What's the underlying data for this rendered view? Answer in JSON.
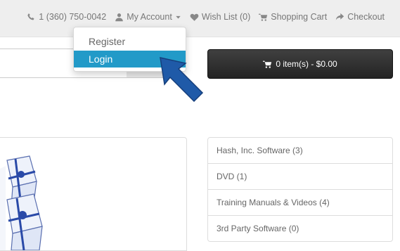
{
  "header": {
    "phone": "1 (360) 750-0042",
    "my_account": "My Account",
    "wish_list": "Wish List (0)",
    "shopping_cart": "Shopping Cart",
    "checkout": "Checkout"
  },
  "account_menu": {
    "register": "Register",
    "login": "Login"
  },
  "cart": {
    "label": "0 item(s) - $0.00"
  },
  "categories": [
    "Hash, Inc. Software (3)",
    "DVD (1)",
    "Training Manuals & Videos (4)",
    "3rd Party Software (0)"
  ],
  "colors": {
    "accent": "#229ac8",
    "arrow": "#1f5aa8",
    "cart_bg": "#303030"
  },
  "icons": {
    "phone": "phone-icon",
    "account": "user-icon",
    "wish": "heart-icon",
    "cart": "cart-icon",
    "checkout": "share-icon"
  }
}
